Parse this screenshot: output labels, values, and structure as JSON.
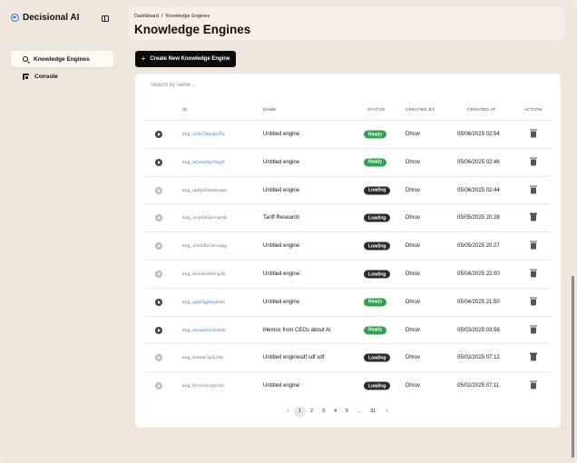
{
  "app": {
    "name": "Decisional AI"
  },
  "sidebar": {
    "items": [
      {
        "label": "Knowledge Engines",
        "icon": "search-icon",
        "active": true
      },
      {
        "label": "Console",
        "icon": "console-icon",
        "active": false
      }
    ]
  },
  "breadcrumb": {
    "parent": "Dashboard",
    "separator": "/",
    "current": "Knowledge Engines"
  },
  "page": {
    "title": "Knowledge Engines"
  },
  "toolbar": {
    "create_label": "Create New Knowledge Engine",
    "create_icon": "+"
  },
  "search": {
    "placeholder": "Search by name..."
  },
  "table": {
    "columns": {
      "id": "ID",
      "name": "NAME",
      "status": "STATUS",
      "created_by": "CREATED BY",
      "created_at": "CREATED AT",
      "action": "ACTION"
    },
    "rows": [
      {
        "id": "kng_i33k74bouhcf5c",
        "name": "Untitled engine",
        "status": "Ready",
        "created_by": "Dhruv",
        "created_at": "05/06/2025 02:54"
      },
      {
        "id": "kng_ut5ewt6p35egff",
        "name": "Untitled engine",
        "status": "Ready",
        "created_by": "Dhruv",
        "created_at": "05/06/2025 02:46"
      },
      {
        "id": "kng_ob0jo05tsnrhqda",
        "name": "Untitled engine",
        "status": "Loading",
        "created_by": "Dhruv",
        "created_at": "05/06/2025 02:44"
      },
      {
        "id": "kng_ocqe6b5pnvgudf",
        "name": "Tariff Research",
        "status": "Loading",
        "created_by": "Dhruv",
        "created_at": "05/05/2025 20:28"
      },
      {
        "id": "kng_43o63br5nvcnpg",
        "name": "Untitled engine",
        "status": "Loading",
        "created_by": "Dhruv",
        "created_at": "05/05/2025 20:27"
      },
      {
        "id": "kng_kh3rkw6rhvg3fc",
        "name": "Untitled engine",
        "status": "Loading",
        "created_by": "Dhruv",
        "created_at": "05/04/2025 22:00"
      },
      {
        "id": "kng_pghi5gpbnjdrnh",
        "name": "Untitled engine",
        "status": "Ready",
        "created_by": "Dhruv",
        "created_at": "05/04/2025 21:50"
      },
      {
        "id": "kng_ewusniyn3rdxrb",
        "name": "Memos from CEOs about AI",
        "status": "Ready",
        "created_by": "Dhruv",
        "created_at": "05/03/2025 03:56"
      },
      {
        "id": "kng_tiarbnr5g5c2zk",
        "name": "Untitled enginesdf sdf sdf",
        "status": "Loading",
        "created_by": "Dhruv",
        "created_at": "05/02/2025 07:12"
      },
      {
        "id": "kng_brvyyuyzpjc2rc",
        "name": "Untitled engine",
        "status": "Loading",
        "created_by": "Dhruv",
        "created_at": "05/02/2025 07:11"
      }
    ]
  },
  "pagination": {
    "prev": "‹",
    "next": "›",
    "pages": [
      "1",
      "2",
      "3",
      "4",
      "5",
      "...",
      "31"
    ],
    "current": "1"
  },
  "colors": {
    "accent": "#2d7be0",
    "ready": "#2fa44f",
    "loading": "#2b2b2b",
    "background": "#efe6dd"
  }
}
